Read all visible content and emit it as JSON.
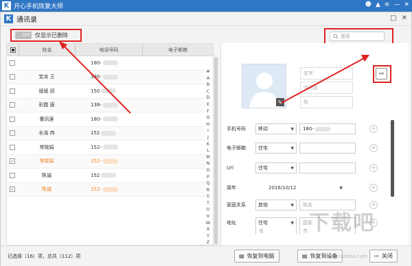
{
  "app": {
    "title": "开心手机恢复大师",
    "logo_letter": "K"
  },
  "window": {
    "title": "通讯录",
    "logo_letter": "K"
  },
  "toolbar": {
    "toggle_state": "OFF",
    "toggle_label": "仅显示已删除",
    "search_placeholder": "搜索"
  },
  "table": {
    "headers": {
      "name": "姓名",
      "phone": "电话号码",
      "email": "电子邮箱"
    },
    "rows": [
      {
        "name": "",
        "phone": "180-",
        "checked": false,
        "deleted": false
      },
      {
        "name": "宝龙 王",
        "phone": "130-",
        "checked": false,
        "deleted": false
      },
      {
        "name": "斌斌 邱",
        "phone": "150",
        "checked": false,
        "deleted": false
      },
      {
        "name": "彩霞 唐",
        "phone": "138-",
        "checked": false,
        "deleted": false
      },
      {
        "name": "曹凤莲",
        "phone": "180-",
        "checked": false,
        "deleted": false
      },
      {
        "name": "长浩 冉",
        "phone": "152",
        "checked": false,
        "deleted": false
      },
      {
        "name": "常晓娟",
        "phone": "152-",
        "checked": false,
        "deleted": false
      },
      {
        "name": "常晓娟",
        "phone": "152-",
        "checked": true,
        "deleted": true
      },
      {
        "name": "陈诚",
        "phone": "152",
        "checked": false,
        "deleted": false
      },
      {
        "name": "陈诚",
        "phone": "152-",
        "checked": true,
        "deleted": true
      }
    ],
    "alphabet": [
      "#",
      "A",
      "B",
      "C",
      "D",
      "E",
      "F",
      "G",
      "H",
      "I",
      "J",
      "K",
      "L",
      "M",
      "N",
      "O",
      "P",
      "Q",
      "R",
      "S",
      "T",
      "U",
      "V",
      "W",
      "X",
      "Y",
      "Z"
    ]
  },
  "detail": {
    "name_placeholder": "名字",
    "middle_placeholder": "中间名",
    "last_placeholder": "姓",
    "fields": {
      "mobile": {
        "label": "手机号码",
        "type": "移动",
        "value": "180-"
      },
      "email": {
        "label": "电子邮箱",
        "type": "住宅"
      },
      "url": {
        "label": "Url",
        "type": "住宅"
      },
      "anniversary": {
        "label": "周年",
        "value": "2016/10/12"
      },
      "family": {
        "label": "家庭关系",
        "type": "其他",
        "placeholder": "姓名"
      },
      "address": {
        "label": "地址",
        "type": "住宅",
        "country_placeholder": "国家",
        "province_placeholder": "省",
        "city_placeholder": "市"
      }
    }
  },
  "status": {
    "text": "已选择（16）项，总共（112）项"
  },
  "buttons": {
    "restore_pc": "恢复到电脑",
    "restore_device": "恢复到设备",
    "close": "关闭"
  },
  "watermark": {
    "main": "下载吧",
    "sub": "www.xiazaiba.com"
  },
  "colors": {
    "titlebar": "#2f76c4",
    "highlight_red": "#e02020",
    "deleted_orange": "#f58220"
  }
}
